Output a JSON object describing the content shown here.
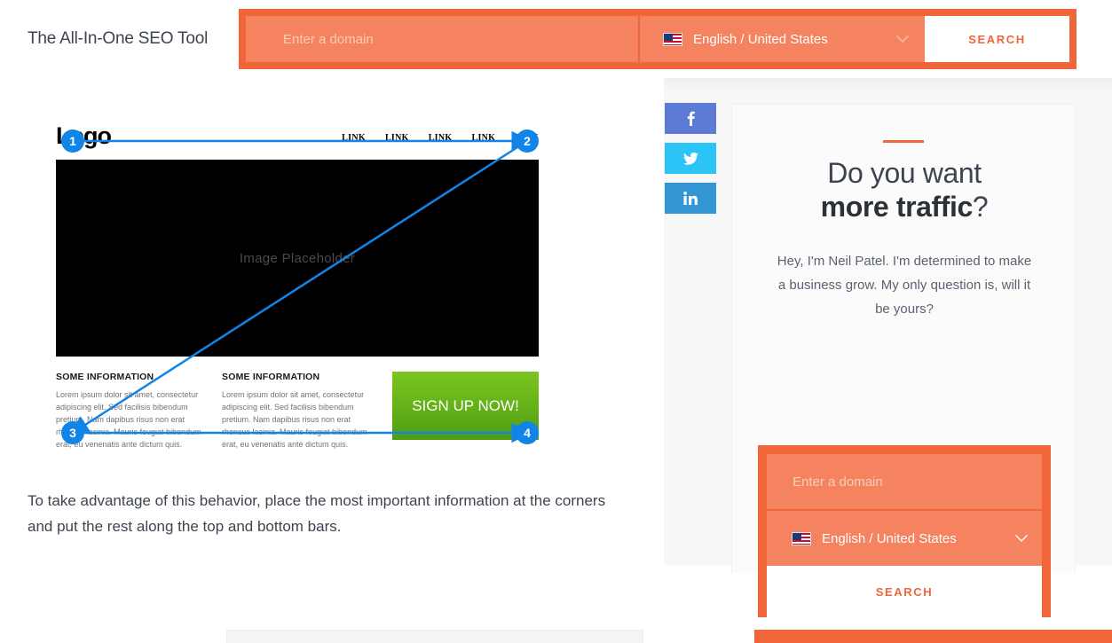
{
  "header": {
    "brand_title": "The All-In-One SEO Tool",
    "search": {
      "domain_placeholder": "Enter a domain",
      "language_label": "English / United States",
      "language_flag_icon": "us-flag-icon",
      "dropdown_icon": "chevron-down-icon",
      "search_button_label": "SEARCH"
    }
  },
  "main": {
    "wireframe": {
      "logo_text": "Logo",
      "nav_links": [
        "LINK",
        "LINK",
        "LINK",
        "LINK",
        "LINK"
      ],
      "hero_placeholder": "Image Placeholder",
      "columns": [
        {
          "heading": "SOME INFORMATION",
          "body": "Lorem ipsum dolor sit amet, consectetur adipiscing elit. Sed facilisis bibendum pretium. Nam dapibus risus non erat rhoncus lacinia. Mauris feugiat bibendum erat, eu venenatis ante dictum quis."
        },
        {
          "heading": "SOME INFORMATION",
          "body": "Lorem ipsum dolor sit amet, consectetur adipiscing elit. Sed facilisis bibendum pretium. Nam dapibus risus non erat rhoncus lacinia. Mauris feugiat bibendum erat, eu venenatis ante dictum quis."
        }
      ],
      "cta_label": "SIGN UP NOW!",
      "markers": [
        "1",
        "2",
        "3",
        "4"
      ],
      "arrow_color": "#1184e8"
    },
    "paragraph": "To take advantage of this behavior, place the most important information at the corners and put the rest along the top and bottom bars."
  },
  "social": [
    {
      "name": "facebook",
      "glyph": "f",
      "color": "#5b7bd5"
    },
    {
      "name": "twitter",
      "glyph": "ᵛ",
      "color": "#2cc3f7"
    },
    {
      "name": "linkedin",
      "glyph": "in",
      "color": "#3495d4"
    }
  ],
  "sidebar": {
    "heading_line1": "Do you want",
    "heading_line2_bold": "more traffic",
    "heading_line2_tail": "?",
    "subtext": "Hey, I'm Neil Patel. I'm determined to make a business grow. My only question is, will it be yours?",
    "form": {
      "domain_placeholder": "Enter a domain",
      "language_label": "English / United States",
      "language_flag_icon": "us-flag-icon",
      "dropdown_icon": "chevron-down-icon",
      "search_button_label": "SEARCH"
    }
  },
  "colors": {
    "accent_orange": "#F0653A",
    "field_orange": "#F58360",
    "arrow_blue": "#1184e8",
    "cta_green_top": "#7cc520",
    "cta_green_bottom": "#4e9e12",
    "text_dark": "#3d4450"
  }
}
